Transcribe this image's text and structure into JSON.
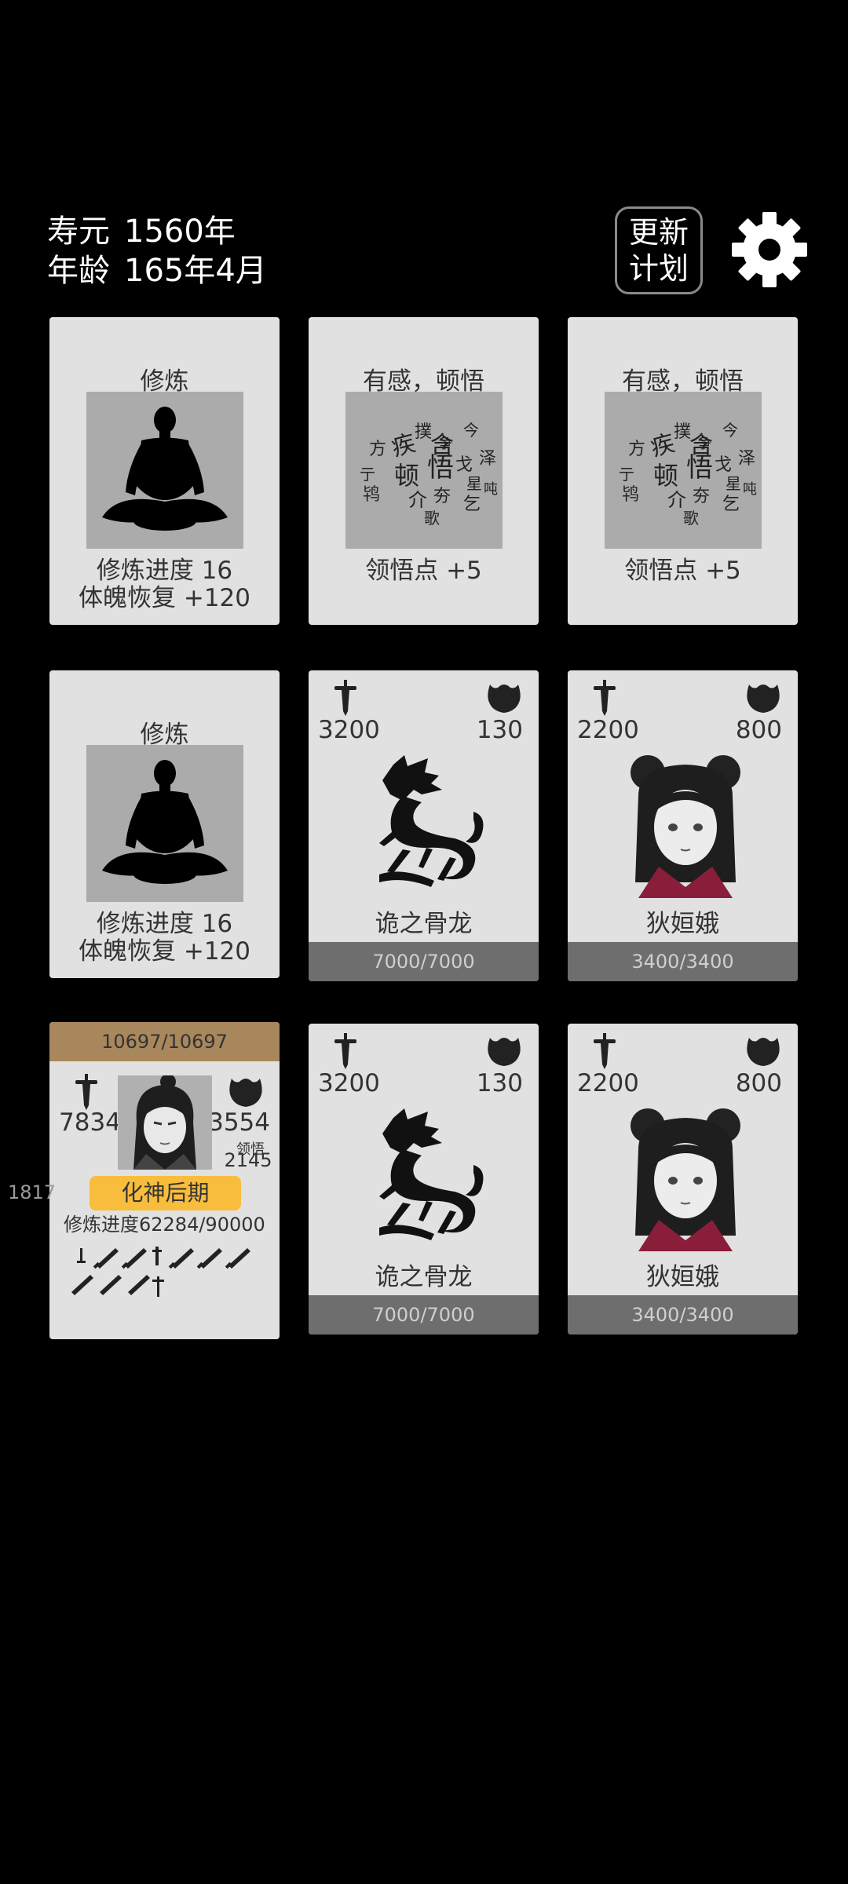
{
  "header": {
    "lifespan_label": "寿元",
    "lifespan_value": "1560年",
    "age_label": "年龄",
    "age_value": "165年4月",
    "update_btn_line1": "更新",
    "update_btn_line2": "计划",
    "settings_icon": "gear-icon"
  },
  "cards": {
    "c1": {
      "title": "修炼",
      "icon": "meditation-icon",
      "line1": "修炼进度  16",
      "line2": "体魄恢复  +120"
    },
    "c2": {
      "title": "有感，顿悟",
      "icon": "enlightenment-calligraphy-icon",
      "line1": "领悟点  +5"
    },
    "c3": {
      "title": "有感，顿悟",
      "icon": "enlightenment-calligraphy-icon",
      "line1": "领悟点  +5"
    },
    "c4": {
      "title": "修炼",
      "icon": "meditation-icon",
      "line1": "修炼进度  16",
      "line2": "体魄恢复  +120"
    },
    "c5": {
      "atk": "3200",
      "def": "130",
      "name": "诡之骨龙",
      "hp": "7000/7000",
      "portrait": "bone-dragon-icon"
    },
    "c6": {
      "atk": "2200",
      "def": "800",
      "name": "狄姮娥",
      "hp": "3400/3400",
      "portrait": "girl-portrait"
    },
    "player": {
      "hp": "10697/10697",
      "atk": "7834",
      "def": "3554",
      "insight_label": "领悟",
      "insight_value": "2145",
      "realm": "化神后期",
      "progress_label": "修炼进度",
      "progress_value": "62284/90000",
      "portrait": "cultivator-portrait"
    },
    "c8": {
      "atk": "3200",
      "def": "130",
      "name": "诡之骨龙",
      "hp": "7000/7000",
      "portrait": "bone-dragon-icon"
    },
    "c9": {
      "atk": "2200",
      "def": "800",
      "name": "狄姮娥",
      "hp": "3400/3400",
      "portrait": "girl-portrait"
    }
  },
  "side_number": "1817",
  "colors": {
    "background": "#000000",
    "card": "#e1e1e1",
    "hp_bar": "#6e6e6e",
    "player_hp_bar": "#a8875c",
    "realm_badge": "#f8bd3c"
  }
}
